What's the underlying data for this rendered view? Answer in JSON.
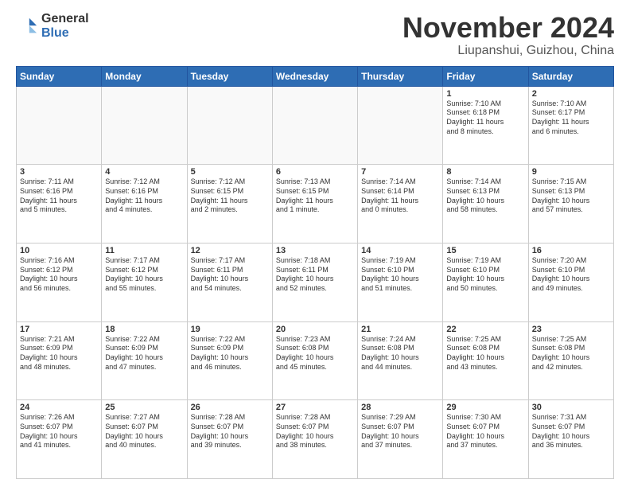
{
  "logo": {
    "general": "General",
    "blue": "Blue"
  },
  "header": {
    "month": "November 2024",
    "location": "Liupanshui, Guizhou, China"
  },
  "weekdays": [
    "Sunday",
    "Monday",
    "Tuesday",
    "Wednesday",
    "Thursday",
    "Friday",
    "Saturday"
  ],
  "weeks": [
    [
      {
        "day": "",
        "info": ""
      },
      {
        "day": "",
        "info": ""
      },
      {
        "day": "",
        "info": ""
      },
      {
        "day": "",
        "info": ""
      },
      {
        "day": "",
        "info": ""
      },
      {
        "day": "1",
        "info": "Sunrise: 7:10 AM\nSunset: 6:18 PM\nDaylight: 11 hours\nand 8 minutes."
      },
      {
        "day": "2",
        "info": "Sunrise: 7:10 AM\nSunset: 6:17 PM\nDaylight: 11 hours\nand 6 minutes."
      }
    ],
    [
      {
        "day": "3",
        "info": "Sunrise: 7:11 AM\nSunset: 6:16 PM\nDaylight: 11 hours\nand 5 minutes."
      },
      {
        "day": "4",
        "info": "Sunrise: 7:12 AM\nSunset: 6:16 PM\nDaylight: 11 hours\nand 4 minutes."
      },
      {
        "day": "5",
        "info": "Sunrise: 7:12 AM\nSunset: 6:15 PM\nDaylight: 11 hours\nand 2 minutes."
      },
      {
        "day": "6",
        "info": "Sunrise: 7:13 AM\nSunset: 6:15 PM\nDaylight: 11 hours\nand 1 minute."
      },
      {
        "day": "7",
        "info": "Sunrise: 7:14 AM\nSunset: 6:14 PM\nDaylight: 11 hours\nand 0 minutes."
      },
      {
        "day": "8",
        "info": "Sunrise: 7:14 AM\nSunset: 6:13 PM\nDaylight: 10 hours\nand 58 minutes."
      },
      {
        "day": "9",
        "info": "Sunrise: 7:15 AM\nSunset: 6:13 PM\nDaylight: 10 hours\nand 57 minutes."
      }
    ],
    [
      {
        "day": "10",
        "info": "Sunrise: 7:16 AM\nSunset: 6:12 PM\nDaylight: 10 hours\nand 56 minutes."
      },
      {
        "day": "11",
        "info": "Sunrise: 7:17 AM\nSunset: 6:12 PM\nDaylight: 10 hours\nand 55 minutes."
      },
      {
        "day": "12",
        "info": "Sunrise: 7:17 AM\nSunset: 6:11 PM\nDaylight: 10 hours\nand 54 minutes."
      },
      {
        "day": "13",
        "info": "Sunrise: 7:18 AM\nSunset: 6:11 PM\nDaylight: 10 hours\nand 52 minutes."
      },
      {
        "day": "14",
        "info": "Sunrise: 7:19 AM\nSunset: 6:10 PM\nDaylight: 10 hours\nand 51 minutes."
      },
      {
        "day": "15",
        "info": "Sunrise: 7:19 AM\nSunset: 6:10 PM\nDaylight: 10 hours\nand 50 minutes."
      },
      {
        "day": "16",
        "info": "Sunrise: 7:20 AM\nSunset: 6:10 PM\nDaylight: 10 hours\nand 49 minutes."
      }
    ],
    [
      {
        "day": "17",
        "info": "Sunrise: 7:21 AM\nSunset: 6:09 PM\nDaylight: 10 hours\nand 48 minutes."
      },
      {
        "day": "18",
        "info": "Sunrise: 7:22 AM\nSunset: 6:09 PM\nDaylight: 10 hours\nand 47 minutes."
      },
      {
        "day": "19",
        "info": "Sunrise: 7:22 AM\nSunset: 6:09 PM\nDaylight: 10 hours\nand 46 minutes."
      },
      {
        "day": "20",
        "info": "Sunrise: 7:23 AM\nSunset: 6:08 PM\nDaylight: 10 hours\nand 45 minutes."
      },
      {
        "day": "21",
        "info": "Sunrise: 7:24 AM\nSunset: 6:08 PM\nDaylight: 10 hours\nand 44 minutes."
      },
      {
        "day": "22",
        "info": "Sunrise: 7:25 AM\nSunset: 6:08 PM\nDaylight: 10 hours\nand 43 minutes."
      },
      {
        "day": "23",
        "info": "Sunrise: 7:25 AM\nSunset: 6:08 PM\nDaylight: 10 hours\nand 42 minutes."
      }
    ],
    [
      {
        "day": "24",
        "info": "Sunrise: 7:26 AM\nSunset: 6:07 PM\nDaylight: 10 hours\nand 41 minutes."
      },
      {
        "day": "25",
        "info": "Sunrise: 7:27 AM\nSunset: 6:07 PM\nDaylight: 10 hours\nand 40 minutes."
      },
      {
        "day": "26",
        "info": "Sunrise: 7:28 AM\nSunset: 6:07 PM\nDaylight: 10 hours\nand 39 minutes."
      },
      {
        "day": "27",
        "info": "Sunrise: 7:28 AM\nSunset: 6:07 PM\nDaylight: 10 hours\nand 38 minutes."
      },
      {
        "day": "28",
        "info": "Sunrise: 7:29 AM\nSunset: 6:07 PM\nDaylight: 10 hours\nand 37 minutes."
      },
      {
        "day": "29",
        "info": "Sunrise: 7:30 AM\nSunset: 6:07 PM\nDaylight: 10 hours\nand 37 minutes."
      },
      {
        "day": "30",
        "info": "Sunrise: 7:31 AM\nSunset: 6:07 PM\nDaylight: 10 hours\nand 36 minutes."
      }
    ]
  ]
}
